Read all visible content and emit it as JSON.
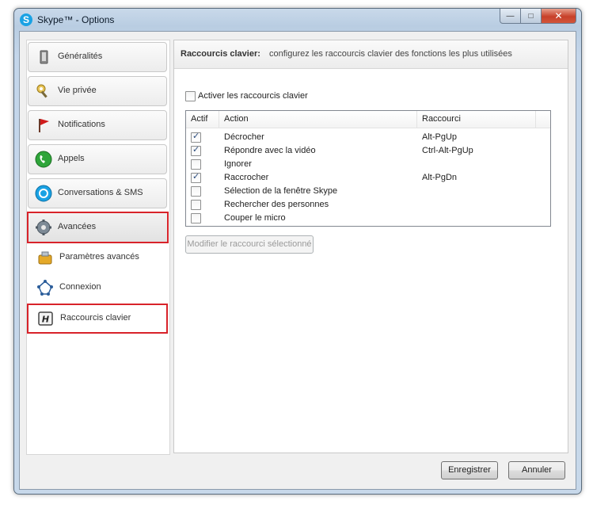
{
  "window": {
    "title": "Skype™ - Options",
    "app_icon": "S"
  },
  "nav": {
    "categories": [
      {
        "label": "Généralités",
        "icon": "general-icon"
      },
      {
        "label": "Vie privée",
        "icon": "privacy-icon"
      },
      {
        "label": "Notifications",
        "icon": "flag-icon"
      },
      {
        "label": "Appels",
        "icon": "phone-icon"
      },
      {
        "label": "Conversations & SMS",
        "icon": "chat-icon"
      },
      {
        "label": "Avancées",
        "icon": "gear-icon"
      }
    ],
    "subitems": [
      {
        "label": "Paramètres avancés",
        "icon": "advanced-settings-icon"
      },
      {
        "label": "Connexion",
        "icon": "connection-icon"
      },
      {
        "label": "Raccourcis clavier",
        "icon": "keyboard-shortcut-icon"
      }
    ]
  },
  "panel": {
    "title": "Raccourcis clavier:",
    "subtitle": "configurez les raccourcis clavier des fonctions les plus utilisées",
    "enable_label": "Activer les raccourcis clavier",
    "enable_checked": false,
    "columns": [
      "Actif",
      "Action",
      "Raccourci"
    ],
    "rows": [
      {
        "active": true,
        "action": "Décrocher",
        "shortcut": "Alt-PgUp"
      },
      {
        "active": true,
        "action": "Répondre avec la vidéo",
        "shortcut": "Ctrl-Alt-PgUp"
      },
      {
        "active": false,
        "action": "Ignorer",
        "shortcut": ""
      },
      {
        "active": true,
        "action": "Raccrocher",
        "shortcut": "Alt-PgDn"
      },
      {
        "active": false,
        "action": "Sélection de la fenêtre Skype",
        "shortcut": ""
      },
      {
        "active": false,
        "action": "Rechercher des personnes",
        "shortcut": ""
      },
      {
        "active": false,
        "action": "Couper le micro",
        "shortcut": ""
      }
    ],
    "modify_button": "Modifier le raccourci sélectionné"
  },
  "footer": {
    "save_label": "Enregistrer",
    "cancel_label": "Annuler"
  },
  "colors": {
    "highlight_border": "#d8232a",
    "skype_blue": "#1aa2e4"
  }
}
